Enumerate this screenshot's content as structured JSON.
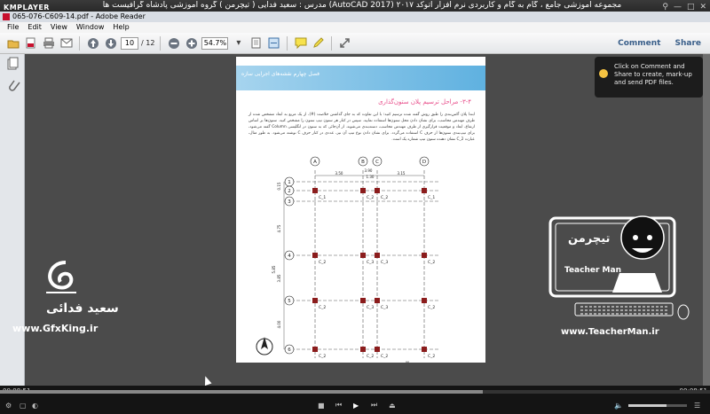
{
  "player": {
    "logo": "KMPLAYER",
    "caption": "مجموعه آموزشی جامع ، گام به گام و کاربردی نرم افزار  اتوکد ۲۰۱۷  (AutoCAD 2017)   مدرس : سعید فدایی ( تیچرمن ) گروه آموزشی پادشاه گرافیست ها",
    "time_elapsed": "00:08:51",
    "time_total": "00:08:51",
    "progress": 0.68,
    "volume": 0.65
  },
  "reader": {
    "window_title": "065-076-C609-14.pdf - Adobe Reader",
    "menu": [
      "File",
      "Edit",
      "View",
      "Window",
      "Help"
    ],
    "page_current": "10",
    "page_total": "/ 12",
    "zoom": "54.7%",
    "links": {
      "comment": "Comment",
      "share": "Share"
    },
    "tooltip": "Click on Comment and Share to create, mark-up and send PDF files."
  },
  "document": {
    "banner": "فصل چهارم  نقشه‌های اجرایی سازه",
    "section_title": "۳-۴- مراحل ترسیم پلان ستون‌گذاری",
    "paragraph": "ابتدا پلان آکس‌بندی را طبق روش گفته شده ترسیم کنید؛ با این تفاوت که به جای گذاشتن خلاصت (#)، از یک مربع به ابعاد مشخص شده از طرف مهندس محاسب، برای نشان دادن محل ستون‌ها استفاده نمایید. سپس در کنار هر ستون تیپ ستون را مشخص کنید. ستون‌ها بر اساس ارتفاع، ابعاد و موقعیت قرارگیری از طرف مهندس محاسب، دسته‌بندی می‌شوند. از آن‌جائی که به ستون در انگلیسی Column گفته می‌شود، برای تیپ‌بندی ستون‌ها از حرف C استفاده می‌گردد. برای نشان دادن نوع تیپ آن نیز، عددی در کنار حرف C نوشته می‌شود. به طور مثال، عبارت C_2 نشان دهنده ستون تیپ شماره یک است.",
    "page_number": "۷۴",
    "plan": {
      "col_labels": [
        "A",
        "B",
        "C",
        "D"
      ],
      "row_labels": [
        "1",
        "2",
        "3",
        "4",
        "5",
        "6"
      ],
      "top_dims": [
        "3.50",
        "3.90",
        "1.30",
        "3.15"
      ],
      "side_dims": [
        "0.15",
        "4.75",
        "3.85",
        "4.00",
        "5.85"
      ],
      "column_tags": [
        "C_1",
        "C_2",
        "C_2",
        "C_1",
        "C_2",
        "C_3",
        "C_3",
        "C_2",
        "C_2",
        "C_3",
        "C_3",
        "C_2",
        "C_2",
        "C_2",
        "C_2",
        "C_2"
      ]
    }
  },
  "watermarks": {
    "left_name": "سعید فدائی",
    "left_url": "www.GfxKing.ir",
    "right_logo_text": "تیچرمن",
    "right_brand": "Teacher Man",
    "right_url": "www.TeacherMan.ir"
  }
}
